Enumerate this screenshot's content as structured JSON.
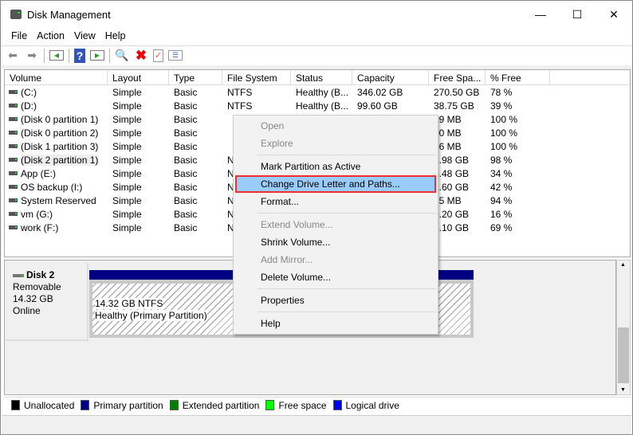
{
  "window": {
    "title": "Disk Management",
    "minimize": "—",
    "maximize": "☐",
    "close": "✕"
  },
  "menubar": [
    "File",
    "Action",
    "View",
    "Help"
  ],
  "toolbar": {
    "back": "back",
    "forward": "forward",
    "console": "console-tree",
    "help": "help",
    "action": "action-pane",
    "connect": "connect",
    "delete": "delete",
    "properties": "properties",
    "list": "list"
  },
  "table": {
    "columns": [
      "Volume",
      "Layout",
      "Type",
      "File System",
      "Status",
      "Capacity",
      "Free Spa...",
      "% Free"
    ],
    "rows": [
      [
        "(C:)",
        "Simple",
        "Basic",
        "NTFS",
        "Healthy (B...",
        "346.02 GB",
        "270.50 GB",
        "78 %"
      ],
      [
        "(D:)",
        "Simple",
        "Basic",
        "NTFS",
        "Healthy (B...",
        "99.60 GB",
        "38.75 GB",
        "39 %"
      ],
      [
        "(Disk 0 partition 1)",
        "Simple",
        "Basic",
        "",
        "",
        "",
        "99 MB",
        "100 %"
      ],
      [
        "(Disk 0 partition 2)",
        "Simple",
        "Basic",
        "",
        "",
        "",
        "00 MB",
        "100 %"
      ],
      [
        "(Disk 1 partition 3)",
        "Simple",
        "Basic",
        "",
        "",
        "",
        "86 MB",
        "100 %"
      ],
      [
        "(Disk 2 partition 1)",
        "Simple",
        "Basic",
        "N",
        "",
        "",
        "3.98 GB",
        "98 %"
      ],
      [
        "App (E:)",
        "Simple",
        "Basic",
        "N",
        "",
        "",
        "4.48 GB",
        "34 %"
      ],
      [
        "OS backup (I:)",
        "Simple",
        "Basic",
        "N",
        "",
        "",
        "1.60 GB",
        "42 %"
      ],
      [
        "System Reserved",
        "Simple",
        "Basic",
        "N",
        "",
        "",
        "15 MB",
        "94 %"
      ],
      [
        "vm (G:)",
        "Simple",
        "Basic",
        "N",
        "",
        "",
        "0.20 GB",
        "16 %"
      ],
      [
        "work (F:)",
        "Simple",
        "Basic",
        "N",
        "",
        "",
        "5.10 GB",
        "69 %"
      ]
    ]
  },
  "disk": {
    "name": "Disk 2",
    "type": "Removable",
    "size": "14.32 GB",
    "state": "Online",
    "partition_size": "14.32 GB NTFS",
    "partition_status": "Healthy (Primary Partition)"
  },
  "legend": [
    {
      "label": "Unallocated",
      "color": "#000000"
    },
    {
      "label": "Primary partition",
      "color": "#000080"
    },
    {
      "label": "Extended partition",
      "color": "#008000"
    },
    {
      "label": "Free space",
      "color": "#00ff00"
    },
    {
      "label": "Logical drive",
      "color": "#0000ff"
    }
  ],
  "context_menu": [
    {
      "label": "Open",
      "disabled": true
    },
    {
      "label": "Explore",
      "disabled": true
    },
    {
      "sep": true
    },
    {
      "label": "Mark Partition as Active"
    },
    {
      "label": "Change Drive Letter and Paths...",
      "highlighted": true
    },
    {
      "label": "Format..."
    },
    {
      "sep": true
    },
    {
      "label": "Extend Volume...",
      "disabled": true
    },
    {
      "label": "Shrink Volume..."
    },
    {
      "label": "Add Mirror...",
      "disabled": true
    },
    {
      "label": "Delete Volume..."
    },
    {
      "sep": true
    },
    {
      "label": "Properties"
    },
    {
      "sep": true
    },
    {
      "label": "Help"
    }
  ]
}
